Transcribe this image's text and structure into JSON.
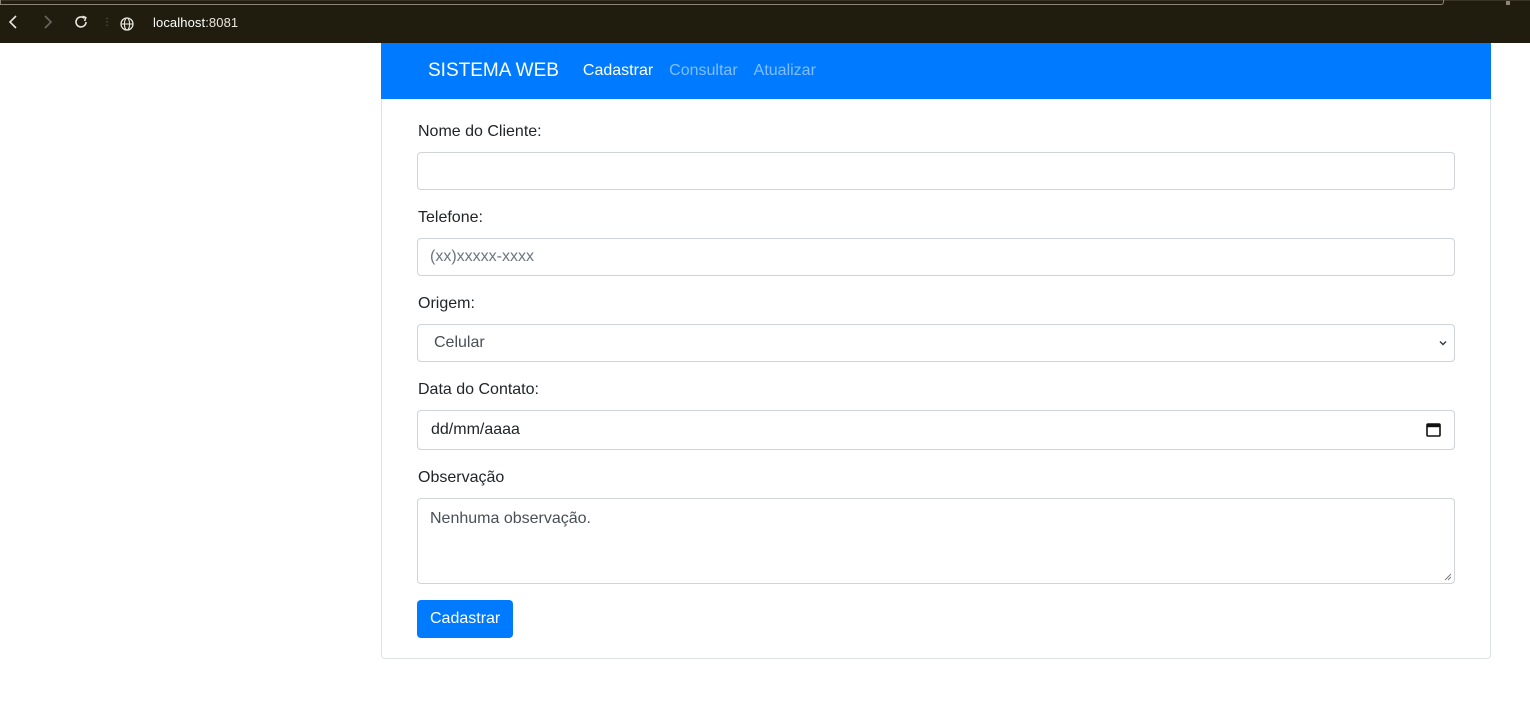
{
  "browser": {
    "url_host": "localhost",
    "url_port": ":8081"
  },
  "navbar": {
    "brand": "SISTEMA WEB",
    "links": [
      {
        "label": "Cadastrar",
        "active": true
      },
      {
        "label": "Consultar",
        "active": false
      },
      {
        "label": "Atualizar",
        "active": false
      }
    ],
    "color": "#007bff"
  },
  "form": {
    "nome": {
      "label": "Nome do Cliente:",
      "value": "",
      "placeholder": ""
    },
    "telefone": {
      "label": "Telefone:",
      "value": "",
      "placeholder": "(xx)xxxxx-xxxx"
    },
    "origem": {
      "label": "Origem:",
      "selected": "Celular"
    },
    "data": {
      "label": "Data do Contato:",
      "value": "dd/mm/aaaa"
    },
    "observacao": {
      "label": "Observação",
      "value": "Nenhuma observação."
    },
    "submit_label": "Cadastrar"
  },
  "icons": {
    "back": "chevron-left-icon",
    "forward": "chevron-right-icon",
    "reload": "reload-icon",
    "site": "globe-icon",
    "select": "chevron-down-icon",
    "date": "calendar-icon",
    "resize": "resize-grip-icon"
  }
}
